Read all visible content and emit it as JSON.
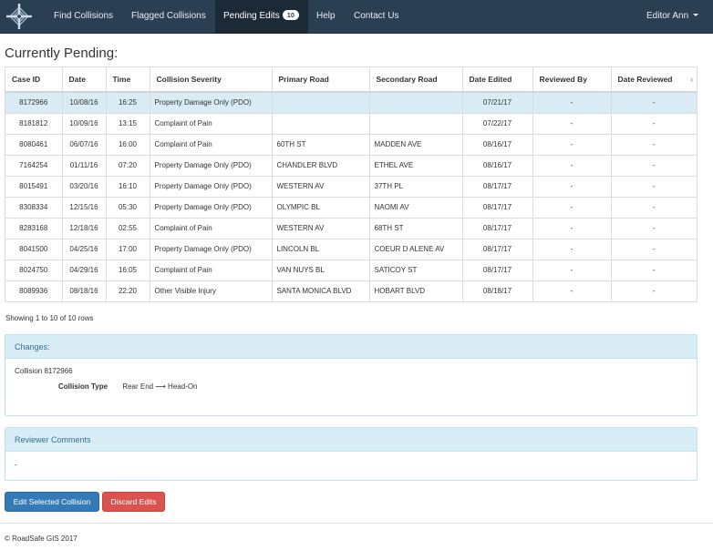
{
  "nav": {
    "items": [
      {
        "label": "Find Collisions"
      },
      {
        "label": "Flagged Collisions"
      },
      {
        "label": "Pending Edits",
        "badge": "10"
      },
      {
        "label": "Help"
      },
      {
        "label": "Contact Us"
      }
    ],
    "user_label": "Editor Ann",
    "brand_icon": "roadsafe-logo-icon",
    "colors": {
      "navbar": "#2b3f53",
      "active": "#1c2a38"
    }
  },
  "page_title": "Currently Pending:",
  "table": {
    "columns": [
      "Case ID",
      "Date",
      "Time",
      "Collision Severity",
      "Primary Road",
      "Secondary Road",
      "Date Edited",
      "Reviewed By",
      "Date Reviewed"
    ],
    "rows": [
      [
        "8172966",
        "10/08/16",
        "16:25",
        "Property Damage Only (PDO)",
        "",
        "",
        "07/21/17",
        "-",
        "-"
      ],
      [
        "8181812",
        "10/09/16",
        "13:15",
        "Complaint of Pain",
        "",
        "",
        "07/22/17",
        "-",
        "-"
      ],
      [
        "8080461",
        "06/07/16",
        "16:00",
        "Complaint of Pain",
        "60TH ST",
        "MADDEN AVE",
        "08/16/17",
        "-",
        "-"
      ],
      [
        "7164254",
        "01/11/16",
        "07:20",
        "Property Damage Only (PDO)",
        "CHANDLER BLVD",
        "ETHEL AVE",
        "08/16/17",
        "-",
        "-"
      ],
      [
        "8015491",
        "03/20/16",
        "16:10",
        "Property Damage Only (PDO)",
        "WESTERN AV",
        "37TH PL",
        "08/17/17",
        "-",
        "-"
      ],
      [
        "8308334",
        "12/15/16",
        "05:30",
        "Property Damage Only (PDO)",
        "OLYMPIC BL",
        "NAOMI AV",
        "08/17/17",
        "-",
        "-"
      ],
      [
        "8283168",
        "12/18/16",
        "02:55",
        "Complaint of Pain",
        "WESTERN AV",
        "68TH ST",
        "08/17/17",
        "-",
        "-"
      ],
      [
        "8041500",
        "04/25/16",
        "17:00",
        "Property Damage Only (PDO)",
        "LINCOLN BL",
        "COEUR D ALENE AV",
        "08/17/17",
        "-",
        "-"
      ],
      [
        "8024750",
        "04/29/16",
        "16:05",
        "Complaint of Pain",
        "VAN NUYS BL",
        "SATICOY ST",
        "08/17/17",
        "-",
        "-"
      ],
      [
        "8089936",
        "08/18/16",
        "22:20",
        "Other Visible Injury",
        "SANTA MONICA BLVD",
        "HOBART BLVD",
        "08/18/17",
        "-",
        "-"
      ]
    ],
    "selected_row": 0
  },
  "pagination_info": "Showing 1 to 10 of 10 rows",
  "changes": {
    "heading": "Changes:",
    "collision_label": "Collision 8172966",
    "field": "Collision Type",
    "from": "Rear End",
    "arrow": "⟶",
    "to": "Head-On"
  },
  "reviewer": {
    "heading": "Reviewer Comments",
    "text": "-"
  },
  "buttons": {
    "edit": "Edit Selected Collision",
    "discard": "Discard Edits"
  },
  "footer": "© RoadSafe GIS 2017"
}
